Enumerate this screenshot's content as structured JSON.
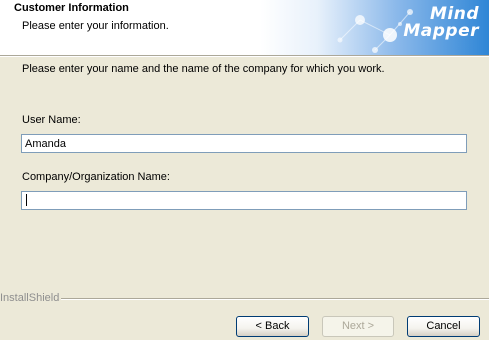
{
  "header": {
    "title": "Customer Information",
    "subtitle": "Please enter your information.",
    "logo_line1": "Mind",
    "logo_line2": "Mapper"
  },
  "instruction": "Please enter your name and the name of the company for which you work.",
  "fields": {
    "user_name": {
      "label": "User Name:",
      "value": "Amanda"
    },
    "company": {
      "label": "Company/Organization Name:",
      "value": ""
    }
  },
  "footer": {
    "brand": "InstallShield"
  },
  "buttons": {
    "back": "< Back",
    "next": "Next >",
    "cancel": "Cancel"
  },
  "colors": {
    "dialog_background": "#ece9d8",
    "banner_accent": "#2f86d6",
    "input_border": "#7f9db9"
  }
}
